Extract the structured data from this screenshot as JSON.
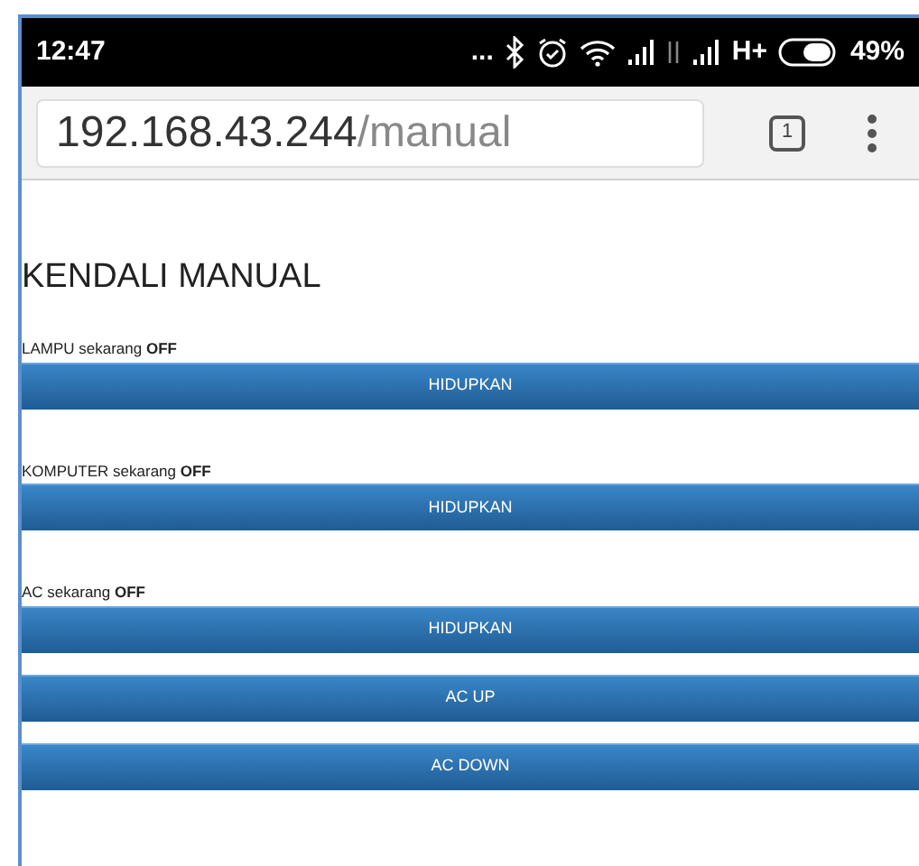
{
  "status_bar": {
    "time": "12:47",
    "overflow": "...",
    "network": "H+",
    "battery": "49%"
  },
  "address_bar": {
    "host": "192.168.43.244",
    "path": "/manual",
    "tab_count": "1"
  },
  "title": "KENDALI MANUAL",
  "devices": [
    {
      "status": "LAMPU sekarang **OFF**",
      "buttons": [
        "HIDUPKAN"
      ]
    },
    {
      "status": "KOMPUTER sekarang **OFF**",
      "buttons": [
        "HIDUPKAN"
      ]
    },
    {
      "status": "AC sekarang **OFF**",
      "buttons": [
        "HIDUPKAN",
        "AC UP",
        "AC DOWN"
      ]
    }
  ]
}
